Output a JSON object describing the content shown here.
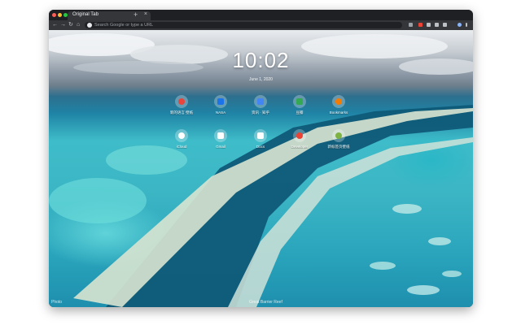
{
  "window": {
    "tab_title": "Original Tab",
    "tab_close": "×",
    "new_tab": "+",
    "traffic_lights": [
      "#ff5f57",
      "#febc2e",
      "#28c840"
    ]
  },
  "toolbar": {
    "back": "←",
    "forward": "→",
    "reload": "↻",
    "home": "⌂",
    "omnibox_placeholder": "Search Google or type a URL",
    "extension_colors": [
      "#9aa0a6",
      "#ea4335",
      "#bdc1c6",
      "#bdc1c6",
      "#bdc1c6",
      "#8ab4f8"
    ]
  },
  "new_tab_page": {
    "clock": "10:02",
    "date": "June 1, 2020",
    "shortcuts": [
      {
        "label": "新的语言 壁纸",
        "icon_color": "#e8453c",
        "icon": "app-icon"
      },
      {
        "label": "NASA",
        "icon_color": "#1a73e8",
        "icon": "app-icon"
      },
      {
        "label": "资讯 · 知乎",
        "icon_color": "#4285f4",
        "icon": "app-icon"
      },
      {
        "label": "豆瓣",
        "icon_color": "#34a853",
        "icon": "app-icon"
      },
      {
        "label": "Bookmarks",
        "icon_color": "#f57c00",
        "icon": "app-icon"
      },
      {
        "label": "iCloud",
        "icon_color": "#ffffff",
        "icon": "app-icon"
      },
      {
        "label": "Gmail",
        "icon_color": "#ffffff",
        "icon": "app-icon"
      },
      {
        "label": "Docs",
        "icon_color": "#ffffff",
        "icon": "app-icon"
      },
      {
        "label": "Developer",
        "icon_color": "#ea4335",
        "icon": "app-icon"
      },
      {
        "label": "新标签页壁纸",
        "icon_color": "#7cb342",
        "icon": "app-icon"
      }
    ],
    "footer_left": "Photo",
    "footer_mid": "Great Barrier Reef"
  }
}
